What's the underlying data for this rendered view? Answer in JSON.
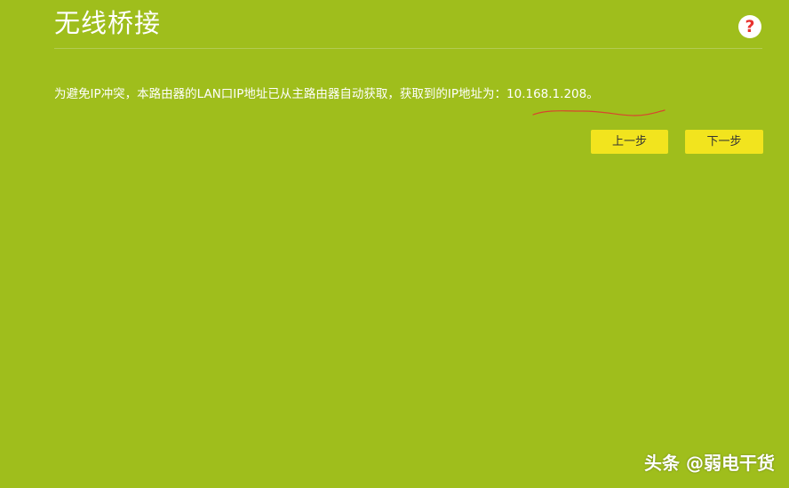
{
  "page": {
    "title": "无线桥接",
    "help_icon": "question-mark-icon",
    "message": "为避免IP冲突，本路由器的LAN口IP地址已从主路由器自动获取，获取到的IP地址为：10.168.1.208。"
  },
  "buttons": {
    "prev_label": "上一步",
    "next_label": "下一步"
  },
  "watermark": {
    "text": "头条 @弱电干货"
  },
  "colors": {
    "background": "#9fbe1c",
    "button": "#f2e41e",
    "help_icon_mark": "#e8322f",
    "annotation_stroke": "#d9442f"
  }
}
